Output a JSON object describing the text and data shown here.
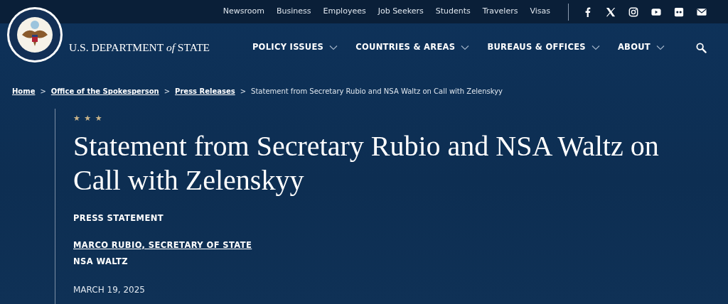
{
  "utility_links": [
    "Newsroom",
    "Business",
    "Employees",
    "Job Seekers",
    "Students",
    "Travelers",
    "Visas"
  ],
  "logo": {
    "text": "U.S. DEPARTMENT *of* STATE"
  },
  "main_nav": [
    {
      "label": "POLICY ISSUES"
    },
    {
      "label": "COUNTRIES & AREAS"
    },
    {
      "label": "BUREAUS & OFFICES"
    },
    {
      "label": "ABOUT"
    }
  ],
  "breadcrumb": [
    {
      "kind": "link",
      "text": "Home"
    },
    {
      "kind": "separator",
      "text": ">"
    },
    {
      "kind": "link",
      "text": "Office of the Spokesperson"
    },
    {
      "kind": "separator",
      "text": ">"
    },
    {
      "kind": "link",
      "text": "Press Releases"
    },
    {
      "kind": "separator",
      "text": ">"
    },
    {
      "kind": "current",
      "text": "Statement from Secretary Rubio and NSA Waltz on Call with Zelenskyy"
    }
  ],
  "article": {
    "ornament": "★ ★ ★",
    "title": "Statement from Secretary Rubio and NSA Waltz on Call with Zelenskyy",
    "type": "PRESS STATEMENT",
    "authors": [
      {
        "text": "MARCO RUBIO, SECRETARY OF STATE",
        "link": true
      },
      {
        "text": "NSA WALTZ",
        "link": false
      }
    ],
    "date": "MARCH 19, 2025"
  }
}
